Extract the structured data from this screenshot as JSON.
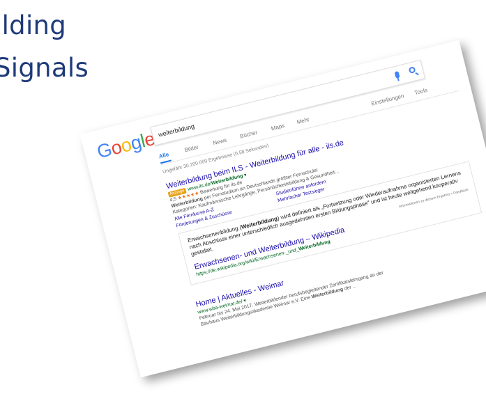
{
  "slide": {
    "title_line1": "ilding",
    "title_line2": "Signals"
  },
  "logo": [
    "G",
    "o",
    "o",
    "g",
    "l",
    "e"
  ],
  "logo_colors": [
    "#4285f4",
    "#ea4335",
    "#fbbc05",
    "#4285f4",
    "#34a853",
    "#ea4335"
  ],
  "search": {
    "query": "weiterbildung",
    "mic_icon": "microphone-icon",
    "search_icon": "magnifier-icon"
  },
  "tabs": [
    {
      "label": "Alle",
      "active": true
    },
    {
      "label": "Bilder"
    },
    {
      "label": "News"
    },
    {
      "label": "Bücher"
    },
    {
      "label": "Maps"
    },
    {
      "label": "Mehr"
    },
    {
      "label": "Einstellungen"
    },
    {
      "label": "Tools"
    }
  ],
  "stats": "Ungefähr 30.200.000 Ergebnisse (0,58 Sekunden)",
  "ad": {
    "title": "Weiterbildung beim ILS - Weiterbildung für alle - ils.de",
    "badge": "Anzeige",
    "url_prefix": "www.ils.de/",
    "url_bold": "Weiterbildung",
    "url_suffix": " ▾",
    "rating_value": "4,5",
    "rating_stars": "★★★★★",
    "rating_text": "Bewertung für ils.de",
    "desc1_bold": "Weiterbildung",
    "desc1_rest": " per Fernstudium an Deutschlands größter Fernschule!",
    "desc2": "Kategorien: Kaufmännische Lehrgänge, Persönlichkeitsbildung & Gesundheit...",
    "sitelinks": [
      "Alle Fernkurse A-Z",
      "Studienführer anfordern",
      "Förderungen & Zuschüsse",
      "Mehrfacher Testsieger"
    ]
  },
  "snippet": {
    "text_pre": "Erwachsenenbildung (",
    "text_bold": "Weiterbildung",
    "text_post": ") wird definiert als „Fortsetzung oder Wiederaufnahme organisierten Lernens nach Abschluss einer unterschiedlich ausgedehnten ersten Bildungsphase\" und ist heute weitgehend kooperativ gestaltet.",
    "meta": "Informationen zu diesem Ergebnis",
    "feedback": "Feedback",
    "title": "Erwachsenen- und Weiterbildung – Wikipedia",
    "url_prefix": "https://de.wikipedia.org/wiki/Erwachsenen-_und_",
    "url_bold": "Weiterbildung"
  },
  "result": {
    "title": "Home | Aktuelles - Weimar",
    "url": "www.wba-weimar.de/ ▾",
    "desc1": "Februar bis 24. Mai 2017. Weiterbildender berufsbegleitender Zertifikatslehrgang an der",
    "desc2_pre": "Bauhaus Weiterbildungsakademie Weimar e.V. Eine ",
    "desc2_bold": "Weiterbildung",
    "desc2_post": " der ..."
  }
}
